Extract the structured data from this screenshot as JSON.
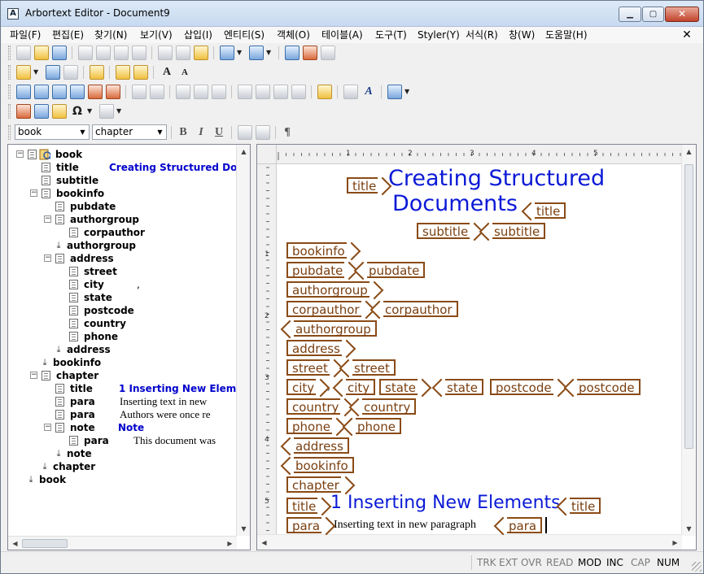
{
  "window": {
    "title": "Arbortext Editor - Document9",
    "app_icon": "A",
    "minimize_glyph": "▁",
    "maximize_glyph": "▢",
    "close_glyph": "✕"
  },
  "menubar": {
    "items": [
      "파일(F)",
      "편집(E)",
      "찾기(N)",
      "보기(V)",
      "삽입(I)",
      "엔티티(S)",
      "객체(O)",
      "테이블(A)",
      "도구(T)",
      "Styler(Y)",
      "서식(R)",
      "창(W)",
      "도움말(H)"
    ],
    "close_glyph": "✕"
  },
  "toolbar": {
    "font_larger": "A",
    "font_smaller": "A",
    "omega": "Ω",
    "bold": "B",
    "italic": "I",
    "underline": "U",
    "pilcrow": "¶",
    "text_style": "A",
    "combo_doctype": "book",
    "combo_element": "chapter"
  },
  "tree": {
    "rows": [
      {
        "name": "book",
        "value": ""
      },
      {
        "name": "title",
        "value": "Creating Structured Doc"
      },
      {
        "name": "subtitle",
        "value": ""
      },
      {
        "name": "bookinfo",
        "value": ""
      },
      {
        "name": "pubdate",
        "value": ""
      },
      {
        "name": "authorgroup",
        "value": ""
      },
      {
        "name": "corpauthor",
        "value": ""
      },
      {
        "name": "authorgroup",
        "value": ""
      },
      {
        "name": "address",
        "value": ""
      },
      {
        "name": "street",
        "value": ""
      },
      {
        "name": "city",
        "value": ","
      },
      {
        "name": "state",
        "value": ""
      },
      {
        "name": "postcode",
        "value": ""
      },
      {
        "name": "country",
        "value": ""
      },
      {
        "name": "phone",
        "value": ""
      },
      {
        "name": "address",
        "value": ""
      },
      {
        "name": "bookinfo",
        "value": ""
      },
      {
        "name": "chapter",
        "value": ""
      },
      {
        "name": "title",
        "value": "1 Inserting New Elem"
      },
      {
        "name": "para",
        "value": "Inserting text in new"
      },
      {
        "name": "para",
        "value": "Authors were once re"
      },
      {
        "name": "note",
        "value": "Note"
      },
      {
        "name": "para",
        "value": "This document was"
      },
      {
        "name": "note",
        "value": ""
      },
      {
        "name": "chapter",
        "value": ""
      },
      {
        "name": "book",
        "value": ""
      }
    ]
  },
  "ruler": {
    "h_numbers": [
      "1",
      "2",
      "3",
      "4",
      "5"
    ],
    "v_numbers": [
      "1",
      "2",
      "3",
      "4",
      "5"
    ]
  },
  "document": {
    "title_text_1": "Creating Structured",
    "title_text_2": "Documents",
    "chapter_title_text": "1 Inserting New Elements",
    "para_text": "Inserting text in new paragraph",
    "comma": ",",
    "tags": {
      "title": "title",
      "subtitle": "subtitle",
      "bookinfo": "bookinfo",
      "pubdate": "pubdate",
      "authorgroup": "authorgroup",
      "corpauthor": "corpauthor",
      "address": "address",
      "street": "street",
      "city": "city",
      "state": "state",
      "postcode": "postcode",
      "country": "country",
      "phone": "phone",
      "chapter": "chapter",
      "para": "para"
    }
  },
  "statusbar": {
    "items": [
      {
        "label": "TRK",
        "active": false
      },
      {
        "label": "EXT",
        "active": false
      },
      {
        "label": "OVR",
        "active": false
      },
      {
        "label": "READ",
        "active": false
      },
      {
        "label": "MOD",
        "active": true
      },
      {
        "label": "INC",
        "active": true
      },
      {
        "label": "CAP",
        "active": false
      },
      {
        "label": "NUM",
        "active": true
      }
    ]
  }
}
